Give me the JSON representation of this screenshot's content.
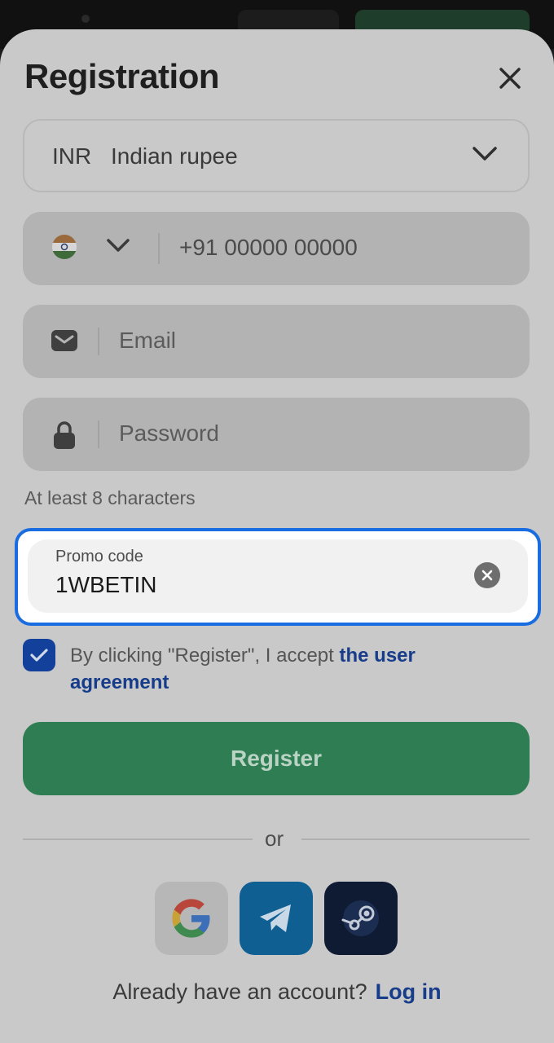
{
  "modal": {
    "title": "Registration",
    "close_icon": "close-icon"
  },
  "currency": {
    "code": "INR",
    "name": "Indian rupee"
  },
  "phone": {
    "country_flag": "india-flag-icon",
    "value": "+91 00000 00000"
  },
  "email": {
    "placeholder": "Email"
  },
  "password": {
    "placeholder": "Password",
    "hint": "At least 8 characters"
  },
  "promo": {
    "label": "Promo code",
    "value": "1WBETIN"
  },
  "agreement": {
    "checked": true,
    "text": "By clicking \"Register\", I accept ",
    "link": "the user agreement"
  },
  "register_label": "Register",
  "divider_text": "or",
  "social": [
    "google-icon",
    "telegram-icon",
    "steam-icon"
  ],
  "footer": {
    "text": "Already have an account?",
    "login": "Log in"
  },
  "colors": {
    "accent_blue": "#1a6de0",
    "register_green": "#2f7d52",
    "link_blue": "#163c8a"
  }
}
